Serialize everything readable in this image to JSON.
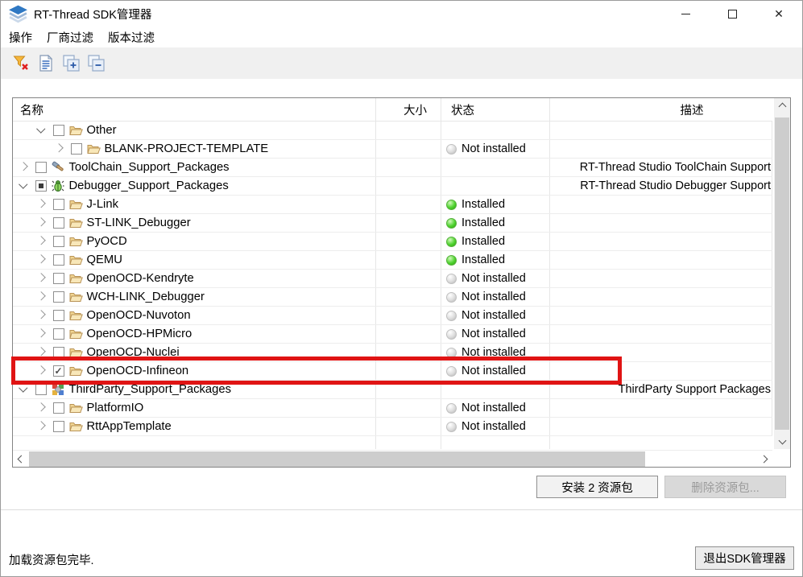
{
  "window": {
    "title": "RT-Thread SDK管理器"
  },
  "window_controls": {
    "minimize": "minimize",
    "maximize": "maximize",
    "close": "close"
  },
  "menu": {
    "items": [
      {
        "label": "操作"
      },
      {
        "label": "厂商过滤"
      },
      {
        "label": "版本过滤"
      }
    ]
  },
  "toolbar": {
    "buttons": [
      {
        "icon": "filter-clear-icon"
      },
      {
        "icon": "document-icon"
      },
      {
        "icon": "expand-all-icon"
      },
      {
        "icon": "collapse-all-icon"
      }
    ]
  },
  "table": {
    "columns": [
      {
        "label": "名称"
      },
      {
        "label": "大小"
      },
      {
        "label": "状态"
      },
      {
        "label": "描述"
      }
    ],
    "rows": [
      {
        "label": "Other",
        "level": 1,
        "chevron": "expanded",
        "checkbox": "unchecked",
        "icon": "folder-icon",
        "size": "",
        "status": null,
        "desc": ""
      },
      {
        "label": "BLANK-PROJECT-TEMPLATE",
        "level": 2,
        "chevron": "collapsed",
        "checkbox": "unchecked",
        "icon": "folder-icon",
        "size": "",
        "status": {
          "state": "not-installed",
          "label": "Not installed"
        },
        "desc": ""
      },
      {
        "label": "ToolChain_Support_Packages",
        "level": 0,
        "chevron": "collapsed",
        "checkbox": "unchecked",
        "icon": "hammer-icon",
        "size": "",
        "status": null,
        "desc": "RT-Thread Studio ToolChain Support"
      },
      {
        "label": "Debugger_Support_Packages",
        "level": 0,
        "chevron": "expanded",
        "checkbox": "partial",
        "icon": "debug-bug-icon",
        "size": "",
        "status": null,
        "desc": "RT-Thread Studio Debugger Support"
      },
      {
        "label": "J-Link",
        "level": 1,
        "chevron": "collapsed",
        "checkbox": "unchecked",
        "icon": "folder-icon",
        "size": "",
        "status": {
          "state": "installed",
          "label": "Installed"
        },
        "desc": ""
      },
      {
        "label": "ST-LINK_Debugger",
        "level": 1,
        "chevron": "collapsed",
        "checkbox": "unchecked",
        "icon": "folder-icon",
        "size": "",
        "status": {
          "state": "installed",
          "label": "Installed"
        },
        "desc": ""
      },
      {
        "label": "PyOCD",
        "level": 1,
        "chevron": "collapsed",
        "checkbox": "unchecked",
        "icon": "folder-icon",
        "size": "",
        "status": {
          "state": "installed",
          "label": "Installed"
        },
        "desc": ""
      },
      {
        "label": "QEMU",
        "level": 1,
        "chevron": "collapsed",
        "checkbox": "unchecked",
        "icon": "folder-icon",
        "size": "",
        "status": {
          "state": "installed",
          "label": "Installed"
        },
        "desc": ""
      },
      {
        "label": "OpenOCD-Kendryte",
        "level": 1,
        "chevron": "collapsed",
        "checkbox": "unchecked",
        "icon": "folder-icon",
        "size": "",
        "status": {
          "state": "not-installed",
          "label": "Not installed"
        },
        "desc": ""
      },
      {
        "label": "WCH-LINK_Debugger",
        "level": 1,
        "chevron": "collapsed",
        "checkbox": "unchecked",
        "icon": "folder-icon",
        "size": "",
        "status": {
          "state": "not-installed",
          "label": "Not installed"
        },
        "desc": ""
      },
      {
        "label": "OpenOCD-Nuvoton",
        "level": 1,
        "chevron": "collapsed",
        "checkbox": "unchecked",
        "icon": "folder-icon",
        "size": "",
        "status": {
          "state": "not-installed",
          "label": "Not installed"
        },
        "desc": ""
      },
      {
        "label": "OpenOCD-HPMicro",
        "level": 1,
        "chevron": "collapsed",
        "checkbox": "unchecked",
        "icon": "folder-icon",
        "size": "",
        "status": {
          "state": "not-installed",
          "label": "Not installed"
        },
        "desc": ""
      },
      {
        "label": "OpenOCD-Nuclei",
        "level": 1,
        "chevron": "collapsed",
        "checkbox": "unchecked",
        "icon": "folder-icon",
        "size": "",
        "status": {
          "state": "not-installed",
          "label": "Not installed"
        },
        "desc": ""
      },
      {
        "label": "OpenOCD-Infineon",
        "level": 1,
        "chevron": "collapsed",
        "checkbox": "checked",
        "icon": "folder-icon",
        "size": "",
        "status": {
          "state": "not-installed",
          "label": "Not installed"
        },
        "desc": "",
        "highlighted": true
      },
      {
        "label": "ThirdParty_Support_Packages",
        "level": 0,
        "chevron": "expanded",
        "checkbox": "unchecked",
        "icon": "plugin-icon",
        "size": "",
        "status": null,
        "desc": "ThirdParty Support Packages"
      },
      {
        "label": "PlatformIO",
        "level": 1,
        "chevron": "collapsed",
        "checkbox": "unchecked",
        "icon": "folder-icon",
        "size": "",
        "status": {
          "state": "not-installed",
          "label": "Not installed"
        },
        "desc": ""
      },
      {
        "label": "RttAppTemplate",
        "level": 1,
        "chevron": "collapsed",
        "checkbox": "unchecked",
        "icon": "folder-icon",
        "size": "",
        "status": {
          "state": "not-installed",
          "label": "Not installed"
        },
        "desc": ""
      }
    ]
  },
  "highlight": {
    "row": "OpenOCD-Infineon",
    "color": "#e01414"
  },
  "actions": {
    "install_label": "安装 2 资源包",
    "delete_label": "删除资源包...",
    "delete_enabled": false
  },
  "statusbar": {
    "message": "加载资源包完毕.",
    "exit_label": "退出SDK管理器"
  },
  "colors": {
    "installed": "#3ccb1b",
    "not_installed": "#d6d6d6",
    "toolbar_bg": "#f0f0f0",
    "highlight_red": "#e01414"
  }
}
